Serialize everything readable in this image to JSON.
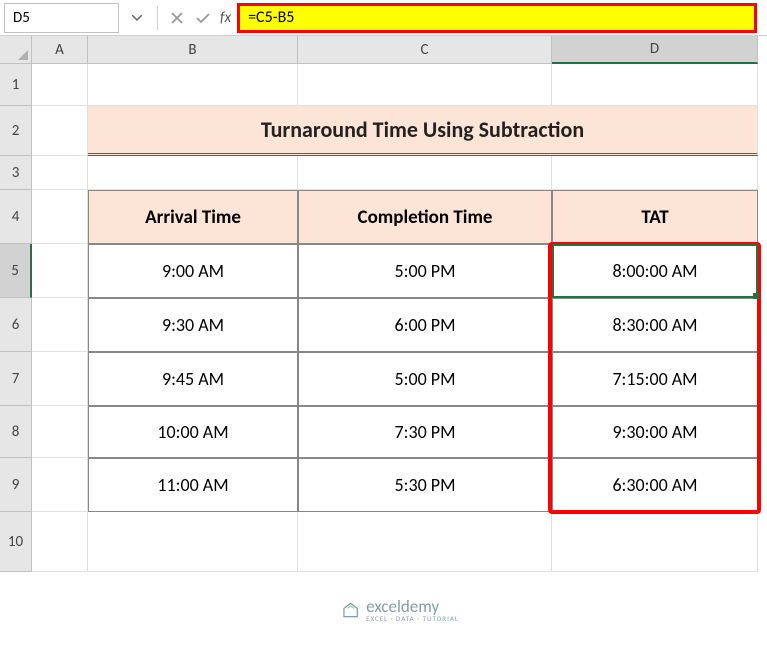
{
  "name_box": "D5",
  "formula": "=C5-B5",
  "col_headers": {
    "A": "A",
    "B": "B",
    "C": "C",
    "D": "D"
  },
  "row_headers": {
    "r1": "1",
    "r2": "2",
    "r3": "3",
    "r4": "4",
    "r5": "5",
    "r6": "6",
    "r7": "7",
    "r8": "8",
    "r9": "9",
    "r10": "10"
  },
  "title": "Turnaround Time Using Subtraction",
  "table": {
    "headers": {
      "arrival": "Arrival Time",
      "completion": "Completion Time",
      "tat": "TAT"
    },
    "rows": [
      {
        "arrival": "9:00 AM",
        "completion": "5:00 PM",
        "tat": "8:00:00 AM"
      },
      {
        "arrival": "9:30 AM",
        "completion": "6:00 PM",
        "tat": "8:30:00 AM"
      },
      {
        "arrival": "9:45 AM",
        "completion": "5:00 PM",
        "tat": "7:15:00 AM"
      },
      {
        "arrival": "10:00 AM",
        "completion": "7:30 PM",
        "tat": "9:30:00 AM"
      },
      {
        "arrival": "11:00 AM",
        "completion": "5:30 PM",
        "tat": "6:30:00 AM"
      }
    ]
  },
  "watermark": {
    "main": "exceldemy",
    "sub": "EXCEL · DATA · TUTORIAL"
  },
  "chart_data": {
    "type": "table",
    "title": "Turnaround Time Using Subtraction",
    "columns": [
      "Arrival Time",
      "Completion Time",
      "TAT"
    ],
    "rows": [
      [
        "9:00 AM",
        "5:00 PM",
        "8:00:00 AM"
      ],
      [
        "9:30 AM",
        "6:00 PM",
        "8:30:00 AM"
      ],
      [
        "9:45 AM",
        "5:00 PM",
        "7:15:00 AM"
      ],
      [
        "10:00 AM",
        "7:30 PM",
        "9:30:00 AM"
      ],
      [
        "11:00 AM",
        "5:30 PM",
        "6:30:00 AM"
      ]
    ],
    "formula_applied": "=C5-B5",
    "active_cell": "D5"
  }
}
